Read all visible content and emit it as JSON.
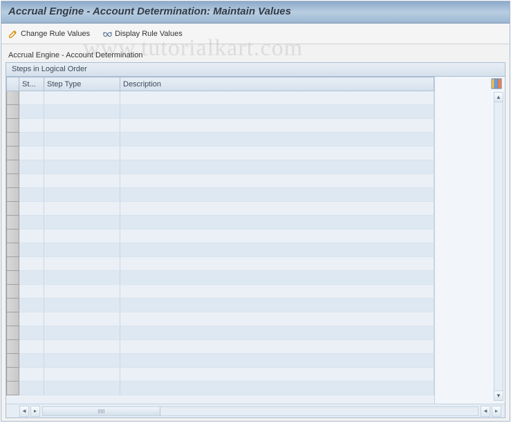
{
  "title": "Accrual Engine - Account Determination: Maintain Values",
  "toolbar": {
    "change_label": "Change Rule Values",
    "display_label": "Display Rule Values"
  },
  "section_label": "Accrual Engine - Account Determination",
  "panel": {
    "header": "Steps in Logical Order",
    "columns": {
      "step": "St...",
      "step_type": "Step Type",
      "description": "Description"
    },
    "rows": [
      {
        "step": "",
        "step_type": "",
        "description": ""
      },
      {
        "step": "",
        "step_type": "",
        "description": ""
      },
      {
        "step": "",
        "step_type": "",
        "description": ""
      },
      {
        "step": "",
        "step_type": "",
        "description": ""
      },
      {
        "step": "",
        "step_type": "",
        "description": ""
      },
      {
        "step": "",
        "step_type": "",
        "description": ""
      },
      {
        "step": "",
        "step_type": "",
        "description": ""
      },
      {
        "step": "",
        "step_type": "",
        "description": ""
      },
      {
        "step": "",
        "step_type": "",
        "description": ""
      },
      {
        "step": "",
        "step_type": "",
        "description": ""
      },
      {
        "step": "",
        "step_type": "",
        "description": ""
      },
      {
        "step": "",
        "step_type": "",
        "description": ""
      },
      {
        "step": "",
        "step_type": "",
        "description": ""
      },
      {
        "step": "",
        "step_type": "",
        "description": ""
      },
      {
        "step": "",
        "step_type": "",
        "description": ""
      },
      {
        "step": "",
        "step_type": "",
        "description": ""
      },
      {
        "step": "",
        "step_type": "",
        "description": ""
      },
      {
        "step": "",
        "step_type": "",
        "description": ""
      },
      {
        "step": "",
        "step_type": "",
        "description": ""
      },
      {
        "step": "",
        "step_type": "",
        "description": ""
      },
      {
        "step": "",
        "step_type": "",
        "description": ""
      },
      {
        "step": "",
        "step_type": "",
        "description": ""
      }
    ]
  },
  "watermark": "www.tutorialkart.com"
}
